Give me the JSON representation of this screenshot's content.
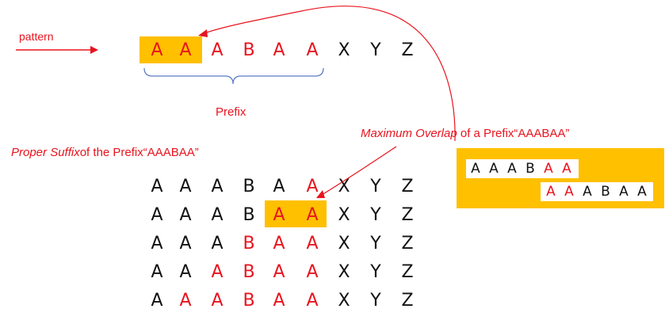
{
  "pattern_label": "pattern",
  "prefix_label": "Prefix",
  "proper_suffix": {
    "emph": "Proper Suffix",
    "rest": "of the Prefix“AAABAA”"
  },
  "max_overlap": {
    "emph": "Maximum Overlap",
    "rest": " of a Prefix“AAABAA”"
  },
  "pattern_row": [
    "A",
    "A",
    "A",
    "B",
    "A",
    "A",
    "X",
    "Y",
    "Z"
  ],
  "pattern_row_red": [
    true,
    true,
    true,
    true,
    true,
    true,
    false,
    false,
    false
  ],
  "suffix_rows": [
    {
      "letters": [
        "A",
        "A",
        "A",
        "B",
        "A",
        "A",
        "X",
        "Y",
        "Z"
      ],
      "red": [
        false,
        false,
        false,
        false,
        false,
        true,
        false,
        false,
        false
      ]
    },
    {
      "letters": [
        "A",
        "A",
        "A",
        "B",
        "A",
        "A",
        "X",
        "Y",
        "Z"
      ],
      "red": [
        false,
        false,
        false,
        false,
        true,
        true,
        false,
        false,
        false
      ]
    },
    {
      "letters": [
        "A",
        "A",
        "A",
        "B",
        "A",
        "A",
        "X",
        "Y",
        "Z"
      ],
      "red": [
        false,
        false,
        false,
        true,
        true,
        true,
        false,
        false,
        false
      ]
    },
    {
      "letters": [
        "A",
        "A",
        "A",
        "B",
        "A",
        "A",
        "X",
        "Y",
        "Z"
      ],
      "red": [
        false,
        false,
        true,
        true,
        true,
        true,
        false,
        false,
        false
      ]
    },
    {
      "letters": [
        "A",
        "A",
        "A",
        "B",
        "A",
        "A",
        "X",
        "Y",
        "Z"
      ],
      "red": [
        false,
        true,
        true,
        true,
        true,
        true,
        false,
        false,
        false
      ]
    }
  ],
  "overlap_box": {
    "top": [
      "A",
      "A",
      "A",
      "B",
      "A",
      "A"
    ],
    "top_red": [
      false,
      false,
      false,
      false,
      true,
      true
    ],
    "bottom": [
      "A",
      "A",
      "A",
      "B",
      "A",
      "A"
    ],
    "bottom_red": [
      true,
      true,
      false,
      false,
      false,
      false
    ]
  },
  "colors": {
    "highlight": "#ffc000",
    "red": "#e8141e",
    "bracket": "#5b7ec8"
  }
}
